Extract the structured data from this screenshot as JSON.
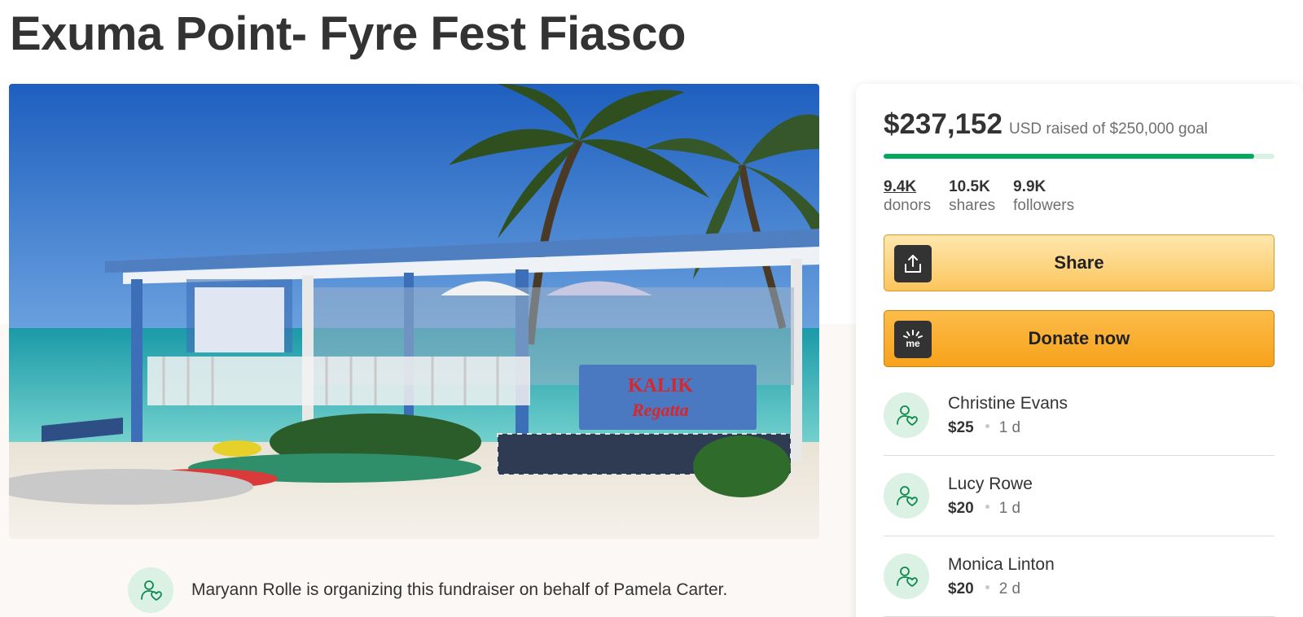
{
  "campaign": {
    "title": "Exuma Point- Fyre Fest Fiasco",
    "organizer_text": "Maryann Rolle is organizing this fundraiser on behalf of Pamela Carter."
  },
  "hero_image": {
    "banner_text_1": "KALIK",
    "banner_text_2": "Regatta"
  },
  "donation_card": {
    "raised_amount": "$237,152",
    "goal_text": "USD raised of $250,000 goal",
    "progress_fraction": 0.9486,
    "stats": [
      {
        "value": "9.4K",
        "label": "donors"
      },
      {
        "value": "10.5K",
        "label": "shares"
      },
      {
        "value": "9.9K",
        "label": "followers"
      }
    ],
    "share_label": "Share",
    "donate_label": "Donate now",
    "donate_icon_text": "me",
    "donors": [
      {
        "name": "Christine Evans",
        "amount": "$25",
        "time": "1 d"
      },
      {
        "name": "Lucy Rowe",
        "amount": "$20",
        "time": "1 d"
      },
      {
        "name": "Monica Linton",
        "amount": "$20",
        "time": "2 d"
      }
    ]
  },
  "colors": {
    "accent_green": "#02a95c",
    "progress_track": "#d7f2e3",
    "avatar_bg": "#daf1e4",
    "donate_orange": "#f7a21b",
    "share_yellow": "#fbc55d"
  },
  "icons": {
    "share": "upload-icon",
    "donate": "gofundme-icon",
    "avatar": "user-heart-icon"
  }
}
